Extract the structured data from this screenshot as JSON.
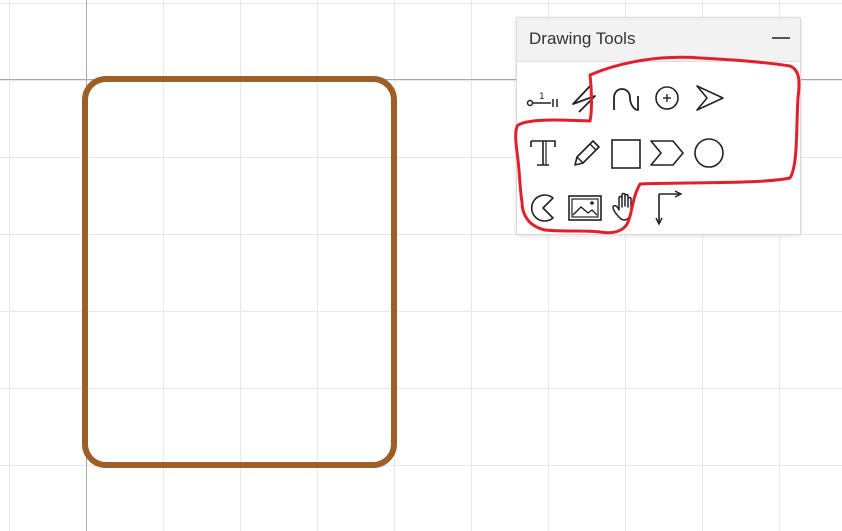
{
  "panel": {
    "title": "Drawing Tools",
    "minimize_icon": "minimize-dash-icon"
  },
  "tools": [
    {
      "name": "number-line-tool",
      "icon": "number-line-icon",
      "glyph_label": "1"
    },
    {
      "name": "zigzag-tool",
      "icon": "zigzag-icon"
    },
    {
      "name": "curve-tool",
      "icon": "curve-icon"
    },
    {
      "name": "add-point-tool",
      "icon": "circle-plus-icon"
    },
    {
      "name": "arrow-tool",
      "icon": "arrow-head-icon"
    },
    {
      "name": "text-tool",
      "icon": "text-icon",
      "glyph": "T"
    },
    {
      "name": "pencil-tool",
      "icon": "pencil-icon"
    },
    {
      "name": "square-tool",
      "icon": "square-icon"
    },
    {
      "name": "chevron-tool",
      "icon": "chevron-icon"
    },
    {
      "name": "circle-tool",
      "icon": "circle-icon"
    },
    {
      "name": "pacman-tool",
      "icon": "pacman-icon"
    },
    {
      "name": "image-tool",
      "icon": "image-icon"
    },
    {
      "name": "hand-tool",
      "icon": "hand-icon"
    },
    {
      "name": "axes-tool",
      "icon": "axes-icon"
    }
  ],
  "colors": {
    "shape_stroke": "#9b5f27",
    "highlight_stroke": "#e2202c",
    "grid": "#e8e8e8",
    "axis": "#a8a8a8",
    "icon": "#222222"
  }
}
